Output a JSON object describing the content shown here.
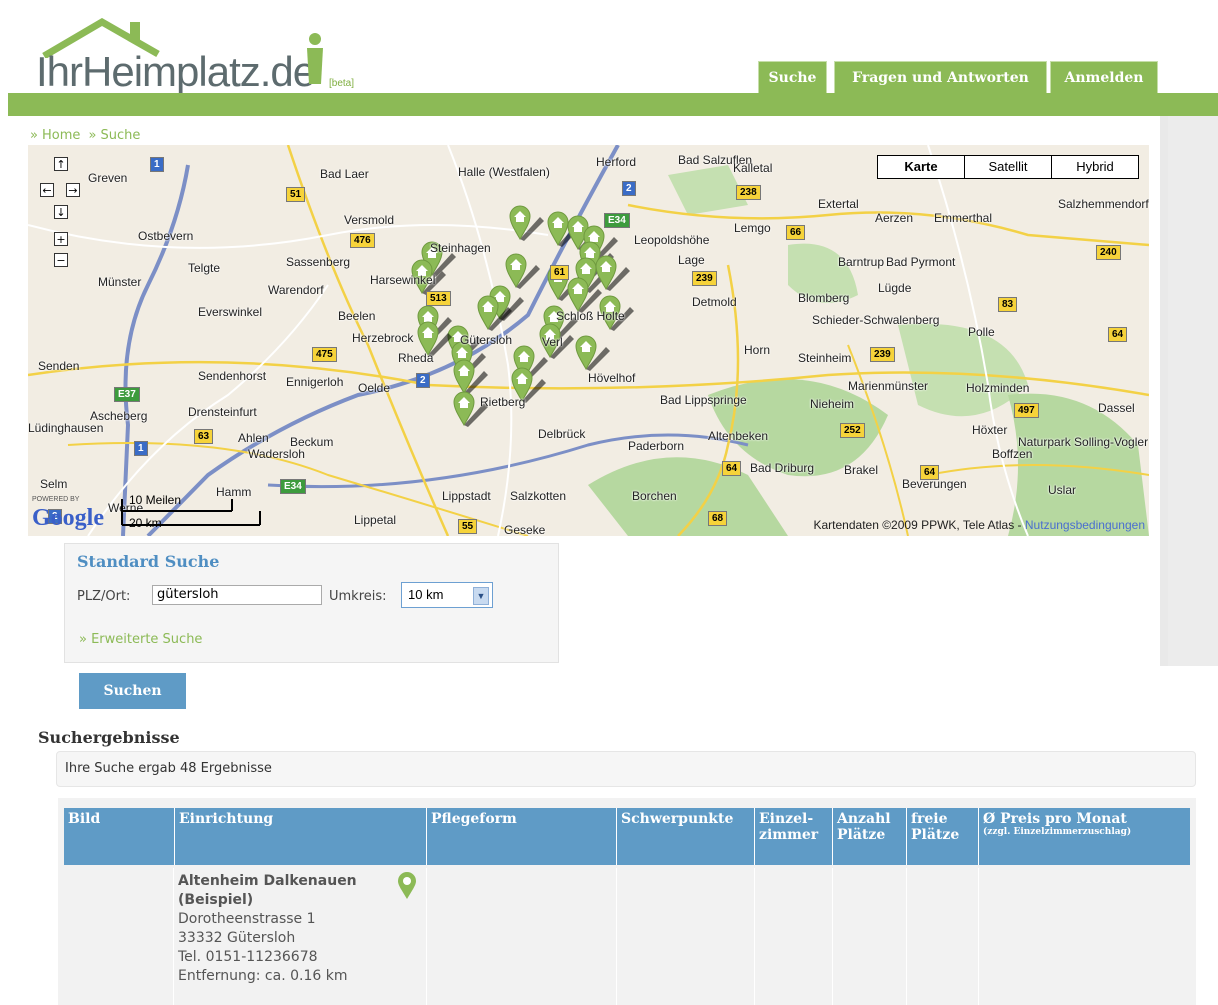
{
  "header": {
    "logo_text": "IhrHeimplatz.de",
    "logo_beta": "[beta]",
    "tabs": [
      {
        "label": "Suche"
      },
      {
        "label": "Fragen und Antworten"
      },
      {
        "label": "Anmelden"
      }
    ]
  },
  "breadcrumb": {
    "sep": "»",
    "items": [
      "Home",
      "Suche"
    ]
  },
  "map": {
    "controls": {
      "pan_up": "↑",
      "pan_left": "←",
      "pan_right": "→",
      "pan_down": "↓",
      "zoom_in": "+",
      "zoom_out": "−"
    },
    "map_types": [
      "Karte",
      "Satellit",
      "Hybrid"
    ],
    "selected_map_type": "Karte",
    "scale": {
      "miles": "10 Meilen",
      "km": "20 km"
    },
    "logo": "Google",
    "powered_by": "POWERED BY",
    "attribution": "Kartendaten ©2009 PPWK, Tele Atlas - ",
    "terms_link": "Nutzungsbedingungen",
    "towns": [
      "Greven",
      "Bad Laer",
      "Halle (Westfalen)",
      "Herford",
      "Bad Salzuflen",
      "Kalletal",
      "Extertal",
      "Salzhemmendorf",
      "Versmold",
      "Lemgo",
      "Aerzen",
      "Emmerthal",
      "Ostbevern",
      "Steinhagen",
      "Leopoldshöhe",
      "Lage",
      "Bad Pyrmont",
      "Barntrup",
      "Telgte",
      "Sassenberg",
      "Harsewinkel",
      "Münster",
      "Warendorf",
      "Detmold",
      "Blomberg",
      "Lügde",
      "Everswinkel",
      "Beelen",
      "Schieder-Schwalenberg",
      "Herzebrock",
      "Gütersloh",
      "Schloß Holte",
      "Verl",
      "Polle",
      "Senden",
      "Rheda",
      "Horn",
      "Steinheim",
      "Sendenhorst",
      "Ennigerloh",
      "Oelde",
      "Hövelhof",
      "Marienmünster",
      "Holzminden",
      "Ascheberg",
      "Drensteinfurt",
      "Rietberg",
      "Bad Lippspringe",
      "Nieheim",
      "Dassel",
      "Lüdinghausen",
      "Ahlen",
      "Beckum",
      "Delbrück",
      "Altenbeken",
      "Höxter",
      "Naturpark Solling-Vogler",
      "Boffzen",
      "Wadersloh",
      "Paderborn",
      "Bad Driburg",
      "Brakel",
      "Selm",
      "Werne",
      "Hamm",
      "Lippstadt",
      "Salzkotten",
      "Borchen",
      "Lippetal",
      "Geseke",
      "Beverungen",
      "Uslar"
    ],
    "road_shields": [
      "1",
      "51",
      "2",
      "238",
      "E34",
      "476",
      "66",
      "240",
      "61",
      "239",
      "513",
      "83",
      "64",
      "475",
      "E37",
      "2",
      "239",
      "497",
      "63",
      "1",
      "252",
      "64",
      "64",
      "E34",
      "55",
      "68",
      "2"
    ],
    "marker_count": 26
  },
  "search": {
    "title": "Standard Suche",
    "plz_label": "PLZ/Ort:",
    "plz_value": "gütersloh",
    "radius_label": "Umkreis:",
    "radius_value": "10 km",
    "extended_link": "» Erweiterte Suche",
    "submit": "Suchen"
  },
  "results": {
    "title": "Suchergebnisse",
    "count_text": "Ihre Suche ergab 48 Ergebnisse",
    "columns": [
      {
        "label": "Bild"
      },
      {
        "label": "Einrichtung"
      },
      {
        "label": "Pflegeform"
      },
      {
        "label": "Schwerpunkte"
      },
      {
        "label": "Einzel-zimmer"
      },
      {
        "label": "Anzahl Plätze"
      },
      {
        "label": "freie Plätze"
      },
      {
        "label": "Ø Preis pro Monat",
        "sub": "(zzgl. Einzelzimmerzuschlag)"
      }
    ],
    "rows": [
      {
        "name": "Altenheim Dalkenauen (Beispiel)",
        "street": "Dorotheenstrasse 1",
        "city": "33332 Gütersloh",
        "phone": "Tel. 0151-11236678",
        "distance": "Entfernung: ca. 0.16 km"
      }
    ]
  },
  "colors": {
    "brand_green": "#8cba56",
    "table_blue": "#5f9bc6",
    "link_green": "#8cba56",
    "title_blue": "#4f8ec2"
  }
}
